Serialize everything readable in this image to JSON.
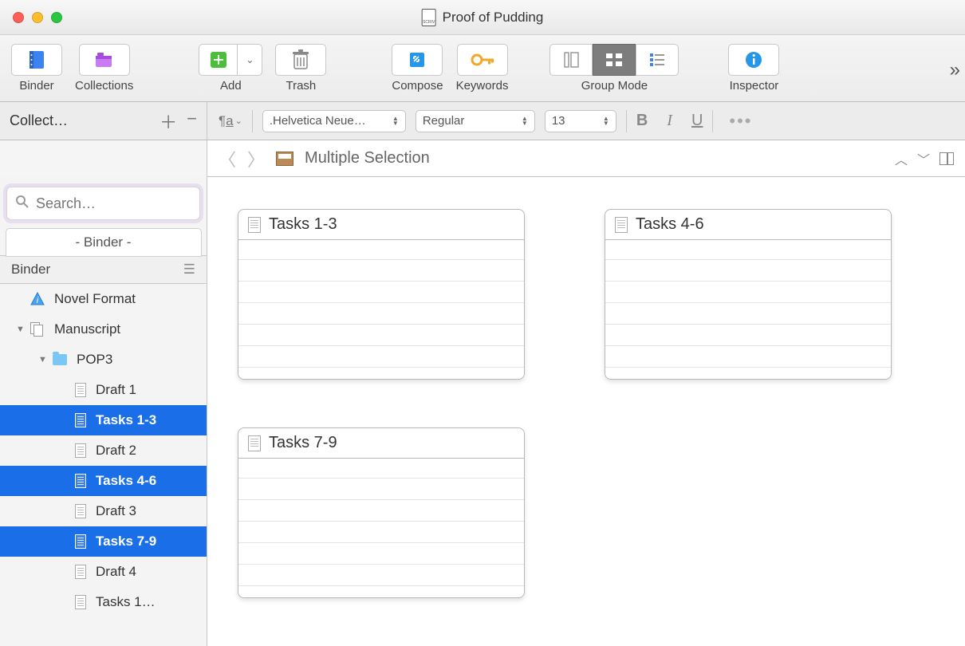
{
  "window": {
    "title": "Proof of Pudding"
  },
  "toolbar": {
    "binder": "Binder",
    "collections": "Collections",
    "add": "Add",
    "trash": "Trash",
    "compose": "Compose",
    "keywords": "Keywords",
    "group_mode": "Group Mode",
    "inspector": "Inspector"
  },
  "collections": {
    "label": "Collect…"
  },
  "format_bar": {
    "font": ".Helvetica Neue…",
    "weight": "Regular",
    "size": "13",
    "bold": "B",
    "italic": "I",
    "underline": "U"
  },
  "pathbar": {
    "title": "Multiple Selection"
  },
  "sidebar": {
    "search_placeholder": "Search…",
    "tab": "- Binder -",
    "header": "Binder",
    "items": [
      {
        "label": "Novel Format",
        "type": "info",
        "depth": 0,
        "disclosure": "",
        "selected": false
      },
      {
        "label": "Manuscript",
        "type": "manuscript",
        "depth": 0,
        "disclosure": "▼",
        "selected": false
      },
      {
        "label": "POP3",
        "type": "folder",
        "depth": 1,
        "disclosure": "▼",
        "selected": false
      },
      {
        "label": "Draft 1",
        "type": "doc",
        "depth": 2,
        "disclosure": "",
        "selected": false
      },
      {
        "label": "Tasks 1-3",
        "type": "doc",
        "depth": 2,
        "disclosure": "",
        "selected": true
      },
      {
        "label": "Draft 2",
        "type": "doc",
        "depth": 2,
        "disclosure": "",
        "selected": false
      },
      {
        "label": "Tasks 4-6",
        "type": "doc",
        "depth": 2,
        "disclosure": "",
        "selected": true
      },
      {
        "label": "Draft 3",
        "type": "doc",
        "depth": 2,
        "disclosure": "",
        "selected": false
      },
      {
        "label": "Tasks 7-9",
        "type": "doc",
        "depth": 2,
        "disclosure": "",
        "selected": true
      },
      {
        "label": "Draft 4",
        "type": "doc",
        "depth": 2,
        "disclosure": "",
        "selected": false
      },
      {
        "label": "Tasks 1…",
        "type": "doc",
        "depth": 2,
        "disclosure": "",
        "selected": false
      }
    ]
  },
  "cards": [
    {
      "title": "Tasks 1-3"
    },
    {
      "title": "Tasks 4-6"
    },
    {
      "title": "Tasks 7-9"
    }
  ]
}
